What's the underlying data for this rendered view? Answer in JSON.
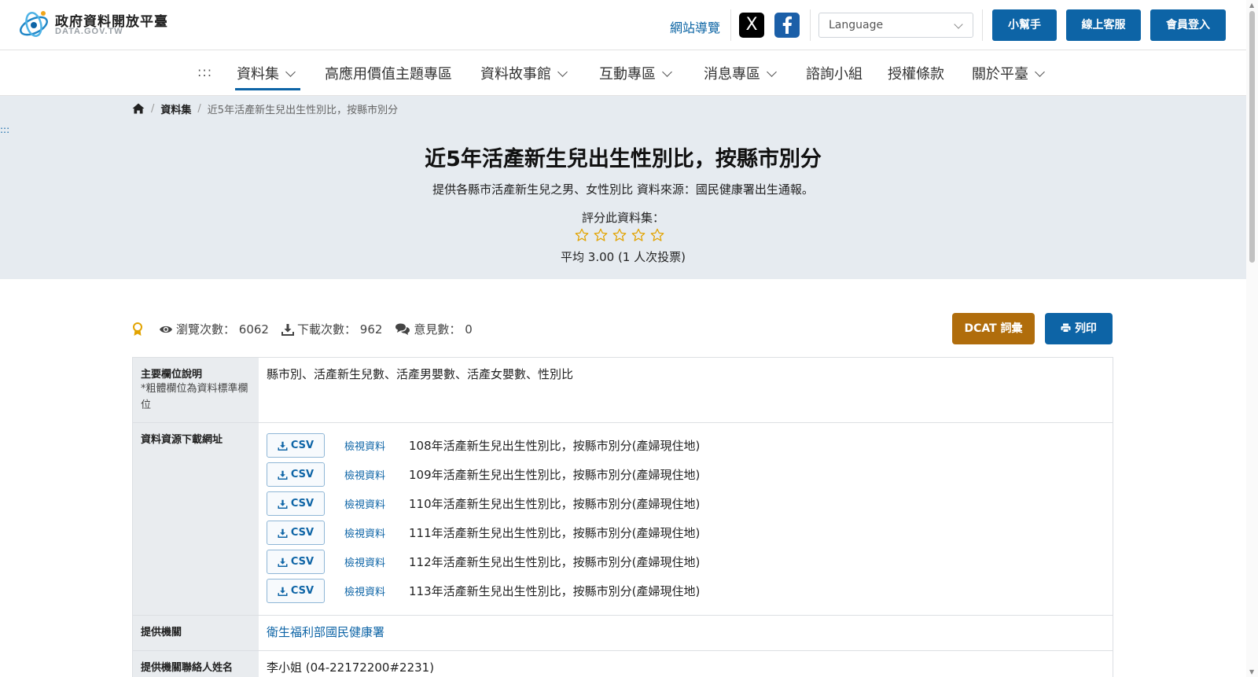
{
  "header": {
    "logo_title": "政府資料開放平臺",
    "logo_sub": "DATA.GOV.TW",
    "sitemap": "網站導覽",
    "social_x": "X",
    "language_placeholder": "Language",
    "helper_button": "小幫手",
    "support_button": "線上客服",
    "login_button": "會員登入"
  },
  "nav": {
    "dots": ":::",
    "items": [
      {
        "label": "資料集",
        "dropdown": true,
        "active": true
      },
      {
        "label": "高應用價值主題專區",
        "dropdown": false
      },
      {
        "label": "資料故事館",
        "dropdown": true
      },
      {
        "label": "互動專區",
        "dropdown": true
      },
      {
        "label": "消息專區",
        "dropdown": true
      },
      {
        "label": "諮詢小組",
        "dropdown": false
      },
      {
        "label": "授權條款",
        "dropdown": false
      },
      {
        "label": "關於平臺",
        "dropdown": true
      }
    ]
  },
  "side_dots": ":::",
  "breadcrumb": {
    "sep": "/",
    "level1": "資料集",
    "current": "近5年活產新生兒出生性別比，按縣市別分"
  },
  "dataset": {
    "title": "近5年活產新生兒出生性別比，按縣市別分",
    "description": "提供各縣市活產新生兒之男、女性別比 資料來源：國民健康署出生通報。",
    "rate_label": "評分此資料集：",
    "stars_total": 5,
    "stars_filled": 0,
    "average": "平均 3.00 (1 人次投票)"
  },
  "stats": {
    "views_label": "瀏覽次數：",
    "views": "6062",
    "downloads_label": "下載次數：",
    "downloads": "962",
    "comments_label": "意見數：",
    "comments": "0"
  },
  "actions": {
    "dcat": "DCAT 詞彙",
    "print": "列印"
  },
  "table": {
    "fields_header": "主要欄位說明",
    "fields_note": "*粗體欄位為資料標準欄位",
    "fields_value": "縣市別、活產新生兒數、活產男嬰數、活產女嬰數、性別比",
    "resources_header": "資料資源下載網址",
    "csv_label": "CSV",
    "view_label": "檢視資料",
    "resources": [
      "108年活產新生兒出生性別比，按縣市別分(產婦現住地)",
      "109年活產新生兒出生性別比，按縣市別分(產婦現住地)",
      "110年活產新生兒出生性別比，按縣市別分(產婦現住地)",
      "111年活產新生兒出生性別比，按縣市別分(產婦現住地)",
      "112年活產新生兒出生性別比，按縣市別分(產婦現住地)",
      "113年活產新生兒出生性別比，按縣市別分(產婦現住地)"
    ],
    "org_header": "提供機關",
    "org_value": "衛生福利部國民健康署",
    "contact_header": "提供機關聯絡人姓名",
    "contact_value": "李小姐 (04-22172200#2231)"
  },
  "colors": {
    "primary": "#0d64a6",
    "dcat": "#b06d0c",
    "hero_bg": "#e6ebf0",
    "star": "#e2a300"
  }
}
